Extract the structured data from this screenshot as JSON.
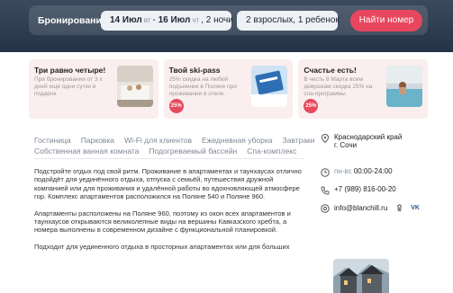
{
  "booking": {
    "title": "Бронирование",
    "date_from": "14 Июл",
    "date_from_day": "вт",
    "separator": "-",
    "date_to": "16 Июл",
    "date_to_day": "чт",
    "nights": ", 2 ночи",
    "guests": "2 взрослых, 1 ребенок",
    "find_button": "Найти номер"
  },
  "promos": [
    {
      "title": "Три равно четыре!",
      "text": "При бронировании от 3 х дней еще одни сутки в подарок",
      "badge": ""
    },
    {
      "title": "Твой ski-pass",
      "text": "25% скидка на любой подъемник в Поляне при проживании в отеле",
      "badge": "25%"
    },
    {
      "title": "Счастье есть!",
      "text": "В честь 8 Марта всем девушкам скидка 25% на спа-программы",
      "badge": "25%"
    }
  ],
  "tabs": {
    "row1": [
      "Гостиница",
      "Парковка",
      "Wi-Fi для клиентов",
      "Ежедневная уборка",
      "Завтраки"
    ],
    "row2": [
      "Собственная ванная комната",
      "Подогреваемый бассейн",
      "Спа-комплекс"
    ]
  },
  "description": {
    "p1": "Подстройте отдых под свой ритм. Проживание в апартаментах и таунхаусах отлично подойдёт для уединённого отдыха, отпуска с семьёй, путешествия дружной компанией или для проживания и удалённой работы во вдохновляющей атмосфере гор. Комплекс апартаментов расположился на Поляне 540 и Поляне 960.",
    "p2": "Апартаменты расположены на Поляне 960, поэтому из окон всех апартаментов и таунхаусов открываются великолепные виды на вершины Кавказского хребта, а номера выполнены в современном дизайне с функциональной планировкой.",
    "p3": "Подходит для уединенного отдыха в просторных апартаментах или для больших"
  },
  "side": {
    "address_line1": "Краснодарский край",
    "address_line2": "г. Сочи",
    "hours_days": "пн-вс",
    "hours_time": "00:00-24:00",
    "phone": "+7 (989) 816-00-20",
    "email": "info@blanchill.ru",
    "vk": "VK"
  },
  "colors": {
    "accent": "#e8465f",
    "header_bg": "#2b3a4d",
    "promo_bg": "#fbeeee"
  }
}
